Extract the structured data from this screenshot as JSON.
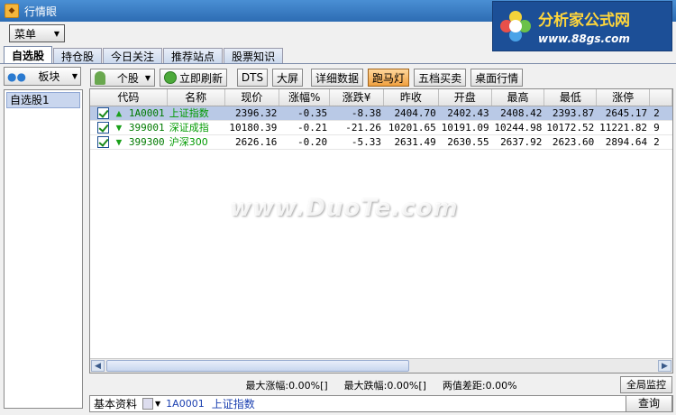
{
  "window": {
    "title": "行情眼"
  },
  "logo": {
    "main": "分析家公式网",
    "url": "www.88gs.com"
  },
  "menu": {
    "label": "菜单"
  },
  "tabs": [
    "自选股",
    "持仓股",
    "今日关注",
    "推荐站点",
    "股票知识"
  ],
  "sidebar": {
    "sector_label": "板块",
    "items": [
      "自选股1"
    ]
  },
  "toolbar": {
    "stock_label": "个股",
    "refresh": "立即刷新",
    "dts": "DTS",
    "bigscreen": "大屏",
    "detail": "详细数据",
    "ticker": "跑马灯",
    "five": "五档买卖",
    "desktop": "桌面行情"
  },
  "table": {
    "headers": [
      "代码",
      "名称",
      "现价",
      "涨幅%",
      "涨跌¥",
      "昨收",
      "开盘",
      "最高",
      "最低",
      "涨停"
    ],
    "rows": [
      {
        "code": "1A0001",
        "name": "上证指数",
        "price": "2396.32",
        "pct": "-0.35",
        "chg": "-8.38",
        "prev": "2404.70",
        "open": "2402.43",
        "high": "2408.42",
        "low": "2393.87",
        "limit": "2645.17",
        "extra": "2"
      },
      {
        "code": "399001",
        "name": "深证成指",
        "price": "10180.39",
        "pct": "-0.21",
        "chg": "-21.26",
        "prev": "10201.65",
        "open": "10191.09",
        "high": "10244.98",
        "low": "10172.52",
        "limit": "11221.82",
        "extra": "9"
      },
      {
        "code": "399300",
        "name": "沪深300",
        "price": "2626.16",
        "pct": "-0.20",
        "chg": "-5.33",
        "prev": "2631.49",
        "open": "2630.55",
        "high": "2637.92",
        "low": "2623.60",
        "limit": "2894.64",
        "extra": "2"
      }
    ]
  },
  "status": {
    "max_up": "最大涨幅:0.00%[]",
    "max_down": "最大跌幅:0.00%[]",
    "diff": "两值差距:0.00%",
    "global": "全局监控"
  },
  "bottom": {
    "label": "基本资料",
    "code": "1A0001",
    "name": "上证指数",
    "query": "查询"
  },
  "watermark": "www.DuoTe.com",
  "colors": {
    "titlebar": "#2d6cb3",
    "selected_row": "#b9c9e6",
    "stock_name": "#009a00"
  }
}
